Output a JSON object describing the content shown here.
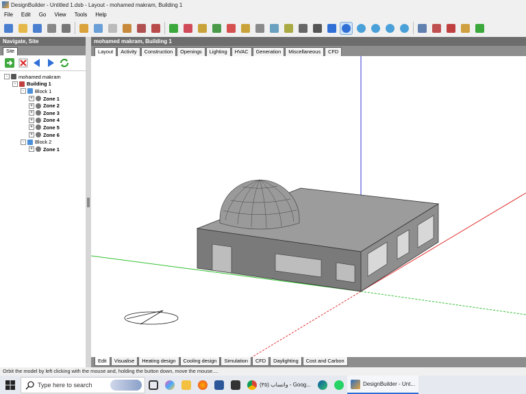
{
  "window": {
    "title": "DesignBuilder - Untitled 1.dsb - Layout - mohamed makram, Building 1"
  },
  "menu": [
    "File",
    "Edit",
    "Go",
    "View",
    "Tools",
    "Help"
  ],
  "toolbar_icons": [
    "new-file-icon",
    "open-folder-icon",
    "save-icon",
    "print-icon",
    "export-icon",
    "wrench-icon",
    "grid-icon",
    "measure-icon",
    "paste-icon",
    "copy-icon",
    "component-icon",
    "select-arrow-icon",
    "heart-icon",
    "shield-icon",
    "block-icon",
    "add-block-icon",
    "pencil-tool-icon",
    "tree-icon",
    "clip-icon",
    "shapes-icon",
    "cube-icon",
    "line-icon",
    "help-cursor-icon",
    "orbit-icon",
    "zoom-in-icon",
    "zoom-extent-icon",
    "zoom-out-icon",
    "zoom-window-icon",
    "layout-icon",
    "grid-view-icon",
    "render-icon",
    "bars-icon",
    "ca-icon"
  ],
  "navigate": {
    "title": "Navigate, Site",
    "tab": "Site",
    "buttons": [
      "forward-arrow-icon",
      "delete-icon",
      "back-icon",
      "next-icon",
      "refresh-icon"
    ],
    "tree": [
      {
        "label": "mohamed makram",
        "bold": false,
        "level": 0,
        "exp": "-",
        "icon": "site"
      },
      {
        "label": "Building 1",
        "bold": true,
        "level": 1,
        "exp": "-",
        "icon": "building"
      },
      {
        "label": "Block 1",
        "bold": false,
        "level": 2,
        "exp": "-",
        "icon": "block"
      },
      {
        "label": "Zone 1",
        "bold": true,
        "level": 3,
        "exp": "+",
        "icon": "zone"
      },
      {
        "label": "Zone 2",
        "bold": true,
        "level": 3,
        "exp": "+",
        "icon": "zone"
      },
      {
        "label": "Zone 3",
        "bold": true,
        "level": 3,
        "exp": "+",
        "icon": "zone"
      },
      {
        "label": "Zone 4",
        "bold": true,
        "level": 3,
        "exp": "+",
        "icon": "zone"
      },
      {
        "label": "Zone 5",
        "bold": true,
        "level": 3,
        "exp": "+",
        "icon": "zone"
      },
      {
        "label": "Zone 6",
        "bold": true,
        "level": 3,
        "exp": "+",
        "icon": "zone"
      },
      {
        "label": "Block 2",
        "bold": false,
        "level": 2,
        "exp": "-",
        "icon": "block"
      },
      {
        "label": "Zone 1",
        "bold": true,
        "level": 3,
        "exp": "+",
        "icon": "zone"
      }
    ]
  },
  "main": {
    "header": "mohamed makram, Building 1",
    "top_tabs": [
      "Layout",
      "Activity",
      "Construction",
      "Openings",
      "Lighting",
      "HVAC",
      "Generation",
      "Miscellaneous",
      "CFD"
    ],
    "top_tab_selected": 0,
    "bottom_tabs": [
      "Edit",
      "Visualise",
      "Heating design",
      "Cooling design",
      "Simulation",
      "CFD",
      "Daylighting",
      "Cost and Carbon"
    ],
    "bottom_tab_selected": 0
  },
  "status": "Orbit the model by left clicking with the mouse and, holding the button down, move the mouse....",
  "taskbar": {
    "search_placeholder": "Type here to search",
    "apps": [
      {
        "label": "واتساب (٣٥) - Goog...",
        "icon": "chrome-icon"
      },
      {
        "label": "DesignBuilder - Unt...",
        "icon": "designbuilder-icon"
      }
    ]
  },
  "colors": {
    "panel_header": "#6d6d6d",
    "tab_strip": "#8d8d8d",
    "axis_x": "#e03030",
    "axis_y": "#30c030",
    "axis_z": "#3030d0",
    "model_face": "#7a7a7a"
  }
}
